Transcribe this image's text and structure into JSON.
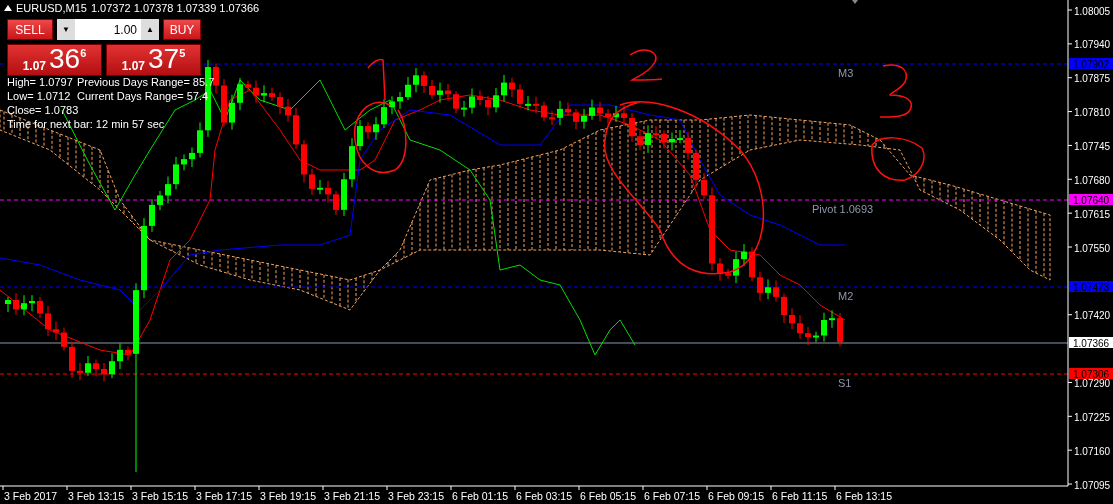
{
  "chart_window": {
    "symbol": "EURUSD,M15",
    "quotes": [
      "1.07372",
      "1.07378",
      "1.07339",
      "1.07366"
    ]
  },
  "trade_panel": {
    "sell_button": "SELL",
    "buy_button": "BUY",
    "volume": "1.00",
    "volume_down": "▼",
    "volume_up": "▲",
    "bid": {
      "prefix": "1.07",
      "pips": "36",
      "fraction": "6"
    },
    "ask": {
      "prefix": "1.07",
      "pips": "37",
      "fraction": "5"
    }
  },
  "info": [
    {
      "left": "High= 1.0797",
      "right": "Previous Days Range= 85.7"
    },
    {
      "left": "Low= 1.0712",
      "right": "Current Days Range= 57.4"
    },
    {
      "left": "Close= 1.0783"
    },
    {
      "left": "Time for next bar: 12 min 57 sec"
    }
  ],
  "levels": [
    {
      "label": "M3",
      "price": "1.07902",
      "color": "#0000ff"
    },
    {
      "label": "Pivot  1.0693",
      "price": "1.07640",
      "color": "#ff00ff"
    },
    {
      "label": "M2",
      "price": "1.07473",
      "color": "#0000ff"
    },
    {
      "label": "S1",
      "price": "1.07306",
      "color": "#ff0000"
    }
  ],
  "current_price": "1.07366",
  "price_axis": [
    "1.08005",
    "1.07940",
    "1.07875",
    "1.07810",
    "1.07745",
    "1.07680",
    "1.07615",
    "1.07550",
    "1.07420",
    "1.07290",
    "1.07225",
    "1.07160",
    "1.07095"
  ],
  "time_axis": [
    "3 Feb 2017",
    "3 Feb 13:15",
    "3 Feb 15:15",
    "3 Feb 17:15",
    "3 Feb 19:15",
    "3 Feb 21:15",
    "3 Feb 23:15",
    "6 Feb 01:15",
    "6 Feb 03:15",
    "6 Feb 05:15",
    "6 Feb 07:15",
    "6 Feb 09:15",
    "6 Feb 11:15",
    "6 Feb 13:15"
  ]
}
